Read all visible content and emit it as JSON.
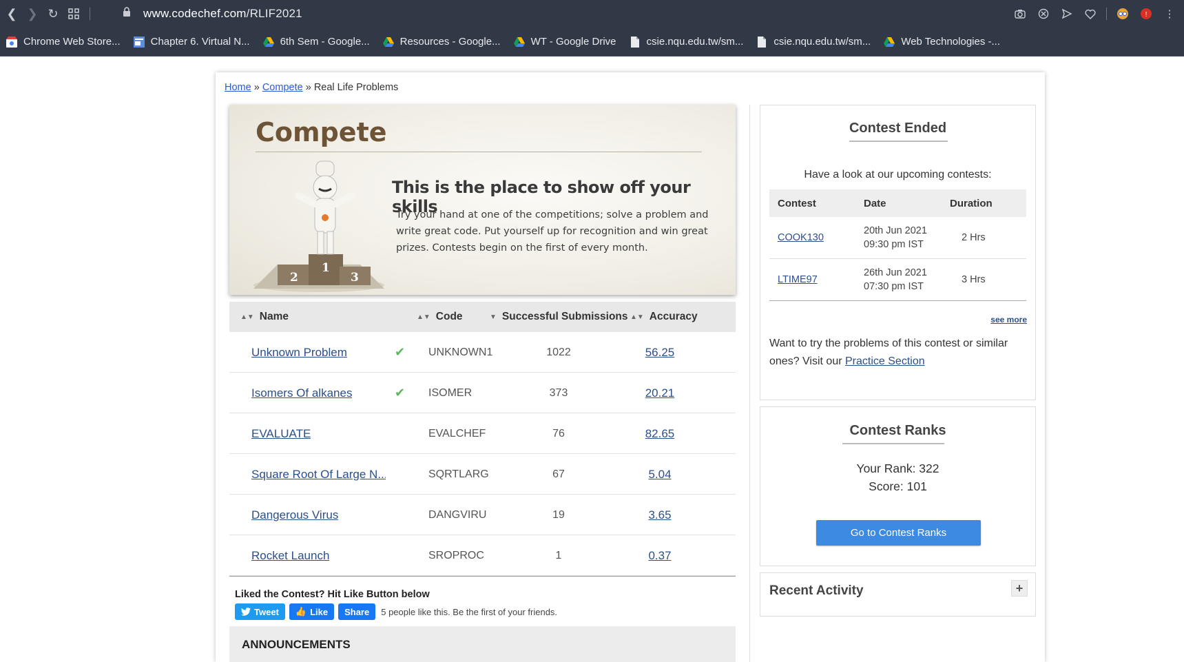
{
  "browser": {
    "url_host": "www.codechef.com",
    "url_path": "/RLIF2021",
    "bookmarks": [
      {
        "label": "Chrome Web Store...",
        "icon": "chrome-webstore-icon"
      },
      {
        "label": "Chapter 6. Virtual N...",
        "icon": "page-thumb-icon"
      },
      {
        "label": "6th Sem - Google...",
        "icon": "google-drive-icon"
      },
      {
        "label": "Resources - Google...",
        "icon": "google-drive-icon"
      },
      {
        "label": "WT - Google Drive",
        "icon": "google-drive-icon"
      },
      {
        "label": "csie.nqu.edu.tw/sm...",
        "icon": "document-icon"
      },
      {
        "label": "csie.nqu.edu.tw/sm...",
        "icon": "document-icon"
      },
      {
        "label": "Web Technologies -...",
        "icon": "google-drive-icon"
      }
    ]
  },
  "breadcrumb": {
    "home": "Home",
    "sep": "»",
    "compete": "Compete",
    "current": "Real Life Problems"
  },
  "banner": {
    "title": "Compete",
    "heading": "This is the place to show off your skills",
    "text": "Try your hand at one of the competitions; solve a problem and write great code. Put yourself up for recognition and win great prizes. Contests begin on the first of every month.",
    "podium": [
      "2",
      "1",
      "3"
    ]
  },
  "problems": {
    "headers": {
      "name": "Name",
      "code": "Code",
      "subs": "Successful Submissions",
      "accuracy": "Accuracy"
    },
    "rows": [
      {
        "name": "Unknown Problem",
        "solved": true,
        "code": "UNKNOWN1",
        "subs": "1022",
        "accuracy": "56.25"
      },
      {
        "name": "Isomers Of alkanes",
        "solved": true,
        "code": "ISOMER",
        "subs": "373",
        "accuracy": "20.21"
      },
      {
        "name": "EVALUATE",
        "solved": false,
        "code": "EVALCHEF",
        "subs": "76",
        "accuracy": "82.65"
      },
      {
        "name": "Square Root Of Large N...",
        "solved": false,
        "code": "SQRTLARG",
        "subs": "67",
        "accuracy": "5.04"
      },
      {
        "name": "Dangerous Virus",
        "solved": false,
        "code": "DANGVIRU",
        "subs": "19",
        "accuracy": "3.65"
      },
      {
        "name": "Rocket Launch",
        "solved": false,
        "code": "SROPROC",
        "subs": "1",
        "accuracy": "0.37"
      }
    ]
  },
  "social": {
    "liked_text": "Liked the Contest? Hit Like Button below",
    "tweet": "Tweet",
    "like": "Like",
    "share": "Share",
    "like_count_text": "5 people like this. Be the first of your friends."
  },
  "announcements": {
    "title": "ANNOUNCEMENTS"
  },
  "contest_ended": {
    "title": "Contest Ended",
    "upcoming_text": "Have a look at our upcoming contests:",
    "headers": {
      "contest": "Contest",
      "date": "Date",
      "duration": "Duration"
    },
    "rows": [
      {
        "code": "COOK130",
        "date1": "20th Jun 2021",
        "date2": "09:30 pm IST",
        "duration": "2 Hrs"
      },
      {
        "code": "LTIME97",
        "date1": "26th Jun 2021",
        "date2": "07:30 pm IST",
        "duration": "3 Hrs"
      }
    ],
    "see_more": "see more",
    "practice_text": "Want to try the problems of this contest or similar ones? Visit our ",
    "practice_link": "Practice Section"
  },
  "ranks": {
    "title": "Contest Ranks",
    "your_rank": "Your Rank: 322",
    "score": "Score: 101",
    "button": "Go to Contest Ranks"
  },
  "activity": {
    "title": "Recent Activity",
    "toggle": "+"
  },
  "colors": {
    "chrome": "#323946",
    "link": "#2a4f8a",
    "button": "#3d8ae2",
    "check": "#5cb85c"
  }
}
